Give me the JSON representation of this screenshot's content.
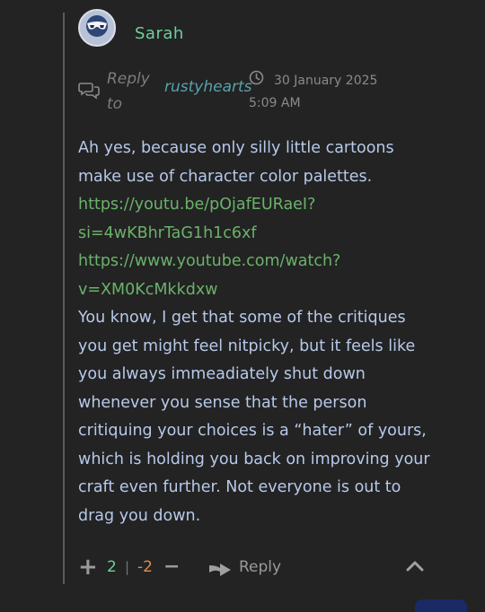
{
  "comment": {
    "author": "Sarah",
    "reply_prefix": "Reply to",
    "reply_target": "rustyhearts",
    "timestamp": "30 January 2025 5:09 AM",
    "body": {
      "intro": "Ah yes, because only silly little cartoons make use of character color palettes.",
      "link1": "https://youtu.be/pOjafEURaeI?si=4wKBhrTaG1h1c6xf",
      "link2": "https://www.youtube.com/watch?v=XM0KcMkkdxw",
      "paragraph": "You know, I get that some of the critiques you get might feel nitpicky, but it feels like you always immeadiately shut down whenever you sense that the person critiquing your choices is a “hater” of yours, which is holding you back on improving your craft even further. Not everyone is out to drag you down."
    },
    "votes": {
      "up": "2",
      "separator": "|",
      "down": "-2",
      "plus_symbol": "+",
      "minus_symbol": "−"
    },
    "reply_label": "Reply"
  },
  "icons": [
    "avatar",
    "reply-bubbles-icon",
    "clock-icon",
    "reply-arrow-icon",
    "chevron-up-icon"
  ],
  "colors": {
    "background": "#232323",
    "author": "#6fcf9c",
    "reply_target": "#5aa1ab",
    "body_text": "#b7c9ea",
    "link": "#6ab26a",
    "upvotes": "#6fcf9c",
    "downvotes": "#e08a4c"
  }
}
